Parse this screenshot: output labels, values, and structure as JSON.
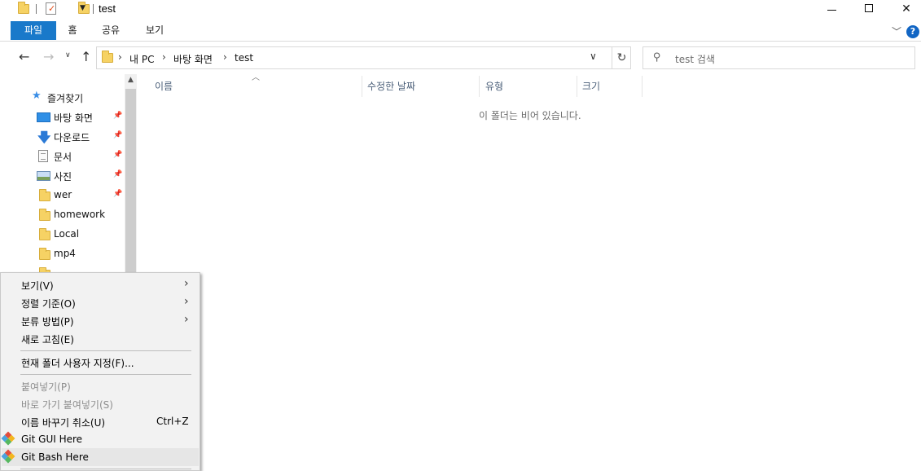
{
  "window": {
    "title": "test"
  },
  "ribbon": {
    "tabs": [
      "파일",
      "홈",
      "공유",
      "보기"
    ]
  },
  "address": {
    "crumbs": [
      "내 PC",
      "바탕 화면",
      "test"
    ],
    "search_placeholder": "test 검색"
  },
  "nav": {
    "quick_access": "즐겨찾기",
    "items": [
      {
        "label": "바탕 화면",
        "icon": "desktop-icon",
        "pinned": true
      },
      {
        "label": "다운로드",
        "icon": "download-icon",
        "pinned": true
      },
      {
        "label": "문서",
        "icon": "document-icon",
        "pinned": true
      },
      {
        "label": "사진",
        "icon": "pictures-icon",
        "pinned": true
      },
      {
        "label": "wer",
        "icon": "folder-icon",
        "pinned": true
      },
      {
        "label": "homework",
        "icon": "folder-icon",
        "pinned": false
      },
      {
        "label": "Local",
        "icon": "folder-icon",
        "pinned": false
      },
      {
        "label": "mp4",
        "icon": "folder-icon",
        "pinned": false
      }
    ]
  },
  "columns": [
    "이름",
    "수정한 날짜",
    "유형",
    "크기"
  ],
  "empty_message": "이 폴더는 비어 있습니다.",
  "context_menu": {
    "items": [
      {
        "label": "보기(V)",
        "submenu": true
      },
      {
        "label": "정렬 기준(O)",
        "submenu": true
      },
      {
        "label": "분류 방법(P)",
        "submenu": true
      },
      {
        "label": "새로 고침(E)"
      },
      {
        "label": "현재 폴더 사용자 지정(F)..."
      },
      {
        "label": "붙여넣기(P)",
        "disabled": true
      },
      {
        "label": "바로 가기 붙여넣기(S)",
        "disabled": true
      },
      {
        "label": "이름 바꾸기 취소(U)",
        "shortcut": "Ctrl+Z"
      },
      {
        "label": "Git GUI Here",
        "icon": "git-icon"
      },
      {
        "label": "Git Bash Here",
        "icon": "git-icon"
      }
    ]
  },
  "colors": {
    "accent": "#1979ca",
    "folder": "#f6d264"
  }
}
